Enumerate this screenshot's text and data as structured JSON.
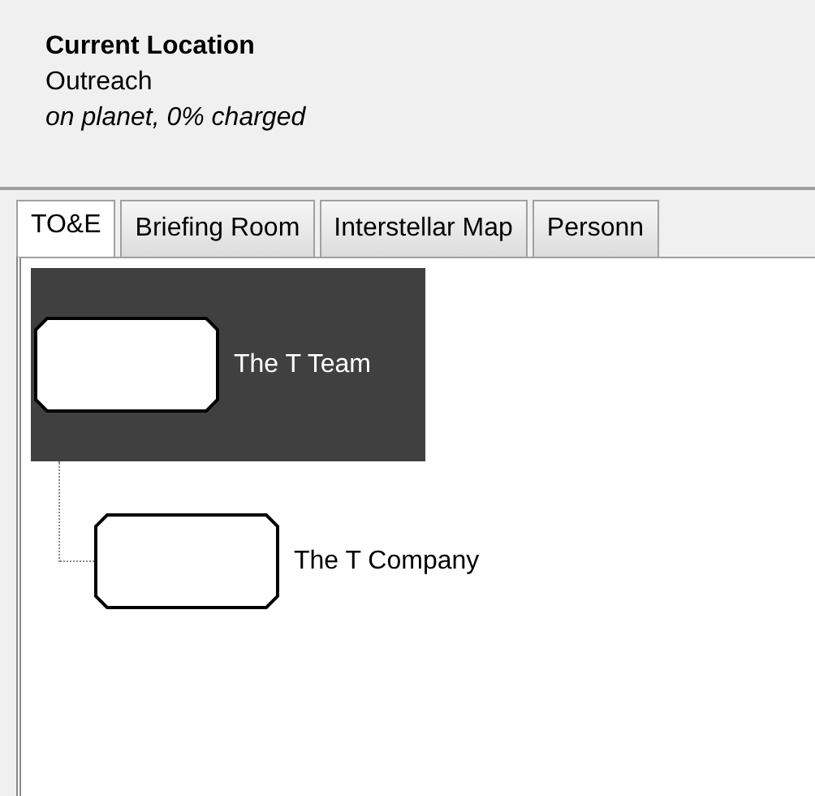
{
  "location": {
    "heading": "Current Location",
    "name": "Outreach",
    "status": "on planet, 0% charged"
  },
  "tabs": [
    {
      "label": "TO&E",
      "selected": true
    },
    {
      "label": "Briefing Room",
      "selected": false
    },
    {
      "label": "Interstellar Map",
      "selected": false
    },
    {
      "label": "Personn",
      "selected": false
    }
  ],
  "tree": [
    {
      "label": "The T Team",
      "selected": true,
      "children": [
        {
          "label": "The T Company",
          "selected": false
        }
      ]
    }
  ]
}
